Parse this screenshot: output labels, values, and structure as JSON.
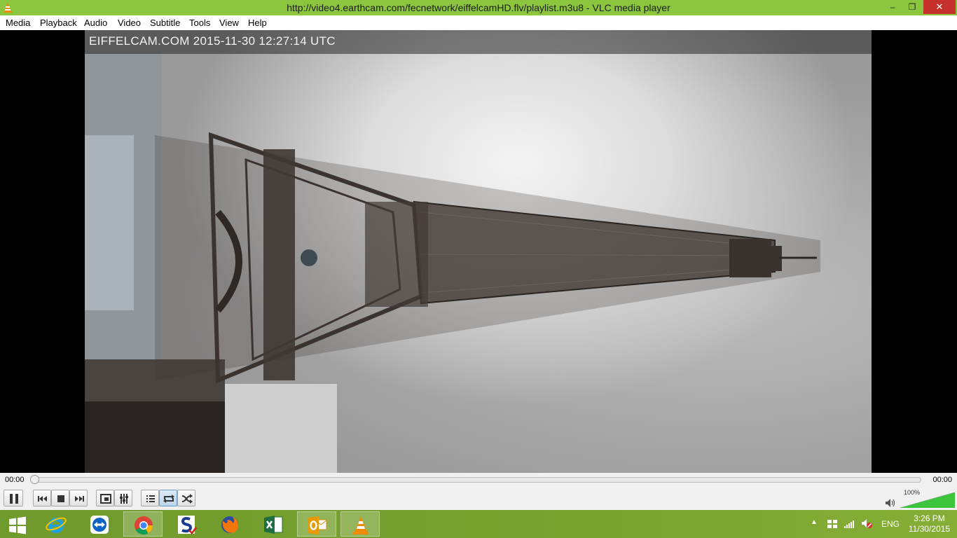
{
  "window": {
    "title": "http://video4.earthcam.com/fecnetwork/eiffelcamHD.flv/playlist.m3u8 - VLC media player",
    "minimize_glyph": "–",
    "maximize_glyph": "❐",
    "close_glyph": "✕"
  },
  "menu": {
    "items": [
      "Media",
      "Playback",
      "Audio",
      "Video",
      "Subtitle",
      "Tools",
      "View",
      "Help"
    ]
  },
  "video": {
    "overlay_text": "EIFFELCAM.COM 2015-11-30 12:27:14 UTC"
  },
  "seek": {
    "elapsed": "00:00",
    "total": "00:00",
    "progress": 0.0
  },
  "controls": {
    "buttons": [
      "pause-icon",
      "previous-icon",
      "stop-icon",
      "next-icon",
      "fullscreen-icon",
      "extended-settings-icon",
      "playlist-icon",
      "loop-icon",
      "shuffle-icon"
    ],
    "volume_label": "100%",
    "volume_level": 1.0
  },
  "taskbar": {
    "apps": [
      "windows-start-icon",
      "internet-explorer-icon",
      "teamviewer-icon",
      "chrome-icon",
      "app-s-icon",
      "firefox-icon",
      "excel-icon",
      "outlook-icon",
      "vlc-icon"
    ],
    "tray": {
      "language": "ENG",
      "time": "3:26 PM",
      "date": "11/30/2015"
    }
  },
  "colors": {
    "titlebar": "#8cc63f",
    "taskbar": "#79a32f",
    "close": "#c7312b",
    "vlc_orange": "#f08a00"
  }
}
